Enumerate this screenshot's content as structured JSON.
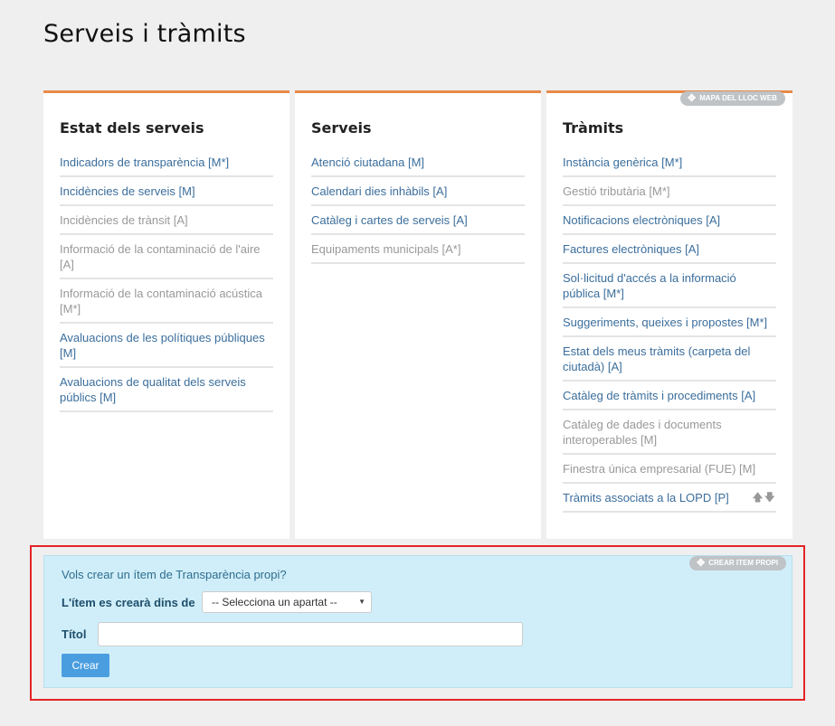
{
  "page": {
    "title": "Serveis i tràmits"
  },
  "columns": [
    {
      "heading": "Estat dels serveis",
      "items": [
        {
          "label": "Indicadors de transparència [M*]",
          "active": true
        },
        {
          "label": "Incidències de serveis [M]",
          "active": true
        },
        {
          "label": "Incidències de trànsit [A]",
          "active": false
        },
        {
          "label": "Informació de la contaminació de l'aire [A]",
          "active": false
        },
        {
          "label": "Informació de la contaminació acústica [M*]",
          "active": false
        },
        {
          "label": "Avaluacions de les polítiques públiques [M]",
          "active": true
        },
        {
          "label": "Avaluacions de qualitat dels serveis públics [M]",
          "active": true
        }
      ]
    },
    {
      "heading": "Serveis",
      "items": [
        {
          "label": "Atenció ciutadana [M]",
          "active": true
        },
        {
          "label": "Calendari dies inhàbils [A]",
          "active": true
        },
        {
          "label": "Catàleg i cartes de serveis [A]",
          "active": true
        },
        {
          "label": "Equipaments municipals [A*]",
          "active": false
        }
      ]
    },
    {
      "heading": "Tràmits",
      "items": [
        {
          "label": "Instància genèrica [M*]",
          "active": true
        },
        {
          "label": "Gestió tributària [M*]",
          "active": false
        },
        {
          "label": "Notificacions electròniques [A]",
          "active": true
        },
        {
          "label": "Factures electròniques [A]",
          "active": true
        },
        {
          "label": "Sol·licitud d'accés a la informació pública [M*]",
          "active": true
        },
        {
          "label": "Suggeriments, queixes i propostes [M*]",
          "active": true
        },
        {
          "label": "Estat dels meus tràmits (carpeta del ciutadà) [A]",
          "active": true
        },
        {
          "label": "Catàleg de tràmits i procediments [A]",
          "active": true
        },
        {
          "label": "Catàleg de dades i documents interoperables [M]",
          "active": false
        },
        {
          "label": "Finestra única empresarial (FUE) [M]",
          "active": false
        },
        {
          "label": "Tràmits associats a la LOPD [P]",
          "active": true,
          "reorder_icons": "🡅🡇"
        }
      ]
    }
  ],
  "badges": {
    "site_map": "MAPA DEL LLOC WEB",
    "create_item": "CREAR ITEM PROPI"
  },
  "create_form": {
    "question": "Vols crear un ítem de Transparència propi?",
    "section_label": "L'ítem es crearà dins de",
    "section_select_value": "-- Selecciona un apartat --",
    "title_label": "Títol",
    "title_value": "",
    "submit_label": "Crear"
  },
  "colors": {
    "accent": "#e8894a",
    "link": "#3b6e9c",
    "muted_link": "#999999",
    "panel_bg": "#d0eef9",
    "button": "#4a9ee0",
    "highlight": "#e32426"
  }
}
